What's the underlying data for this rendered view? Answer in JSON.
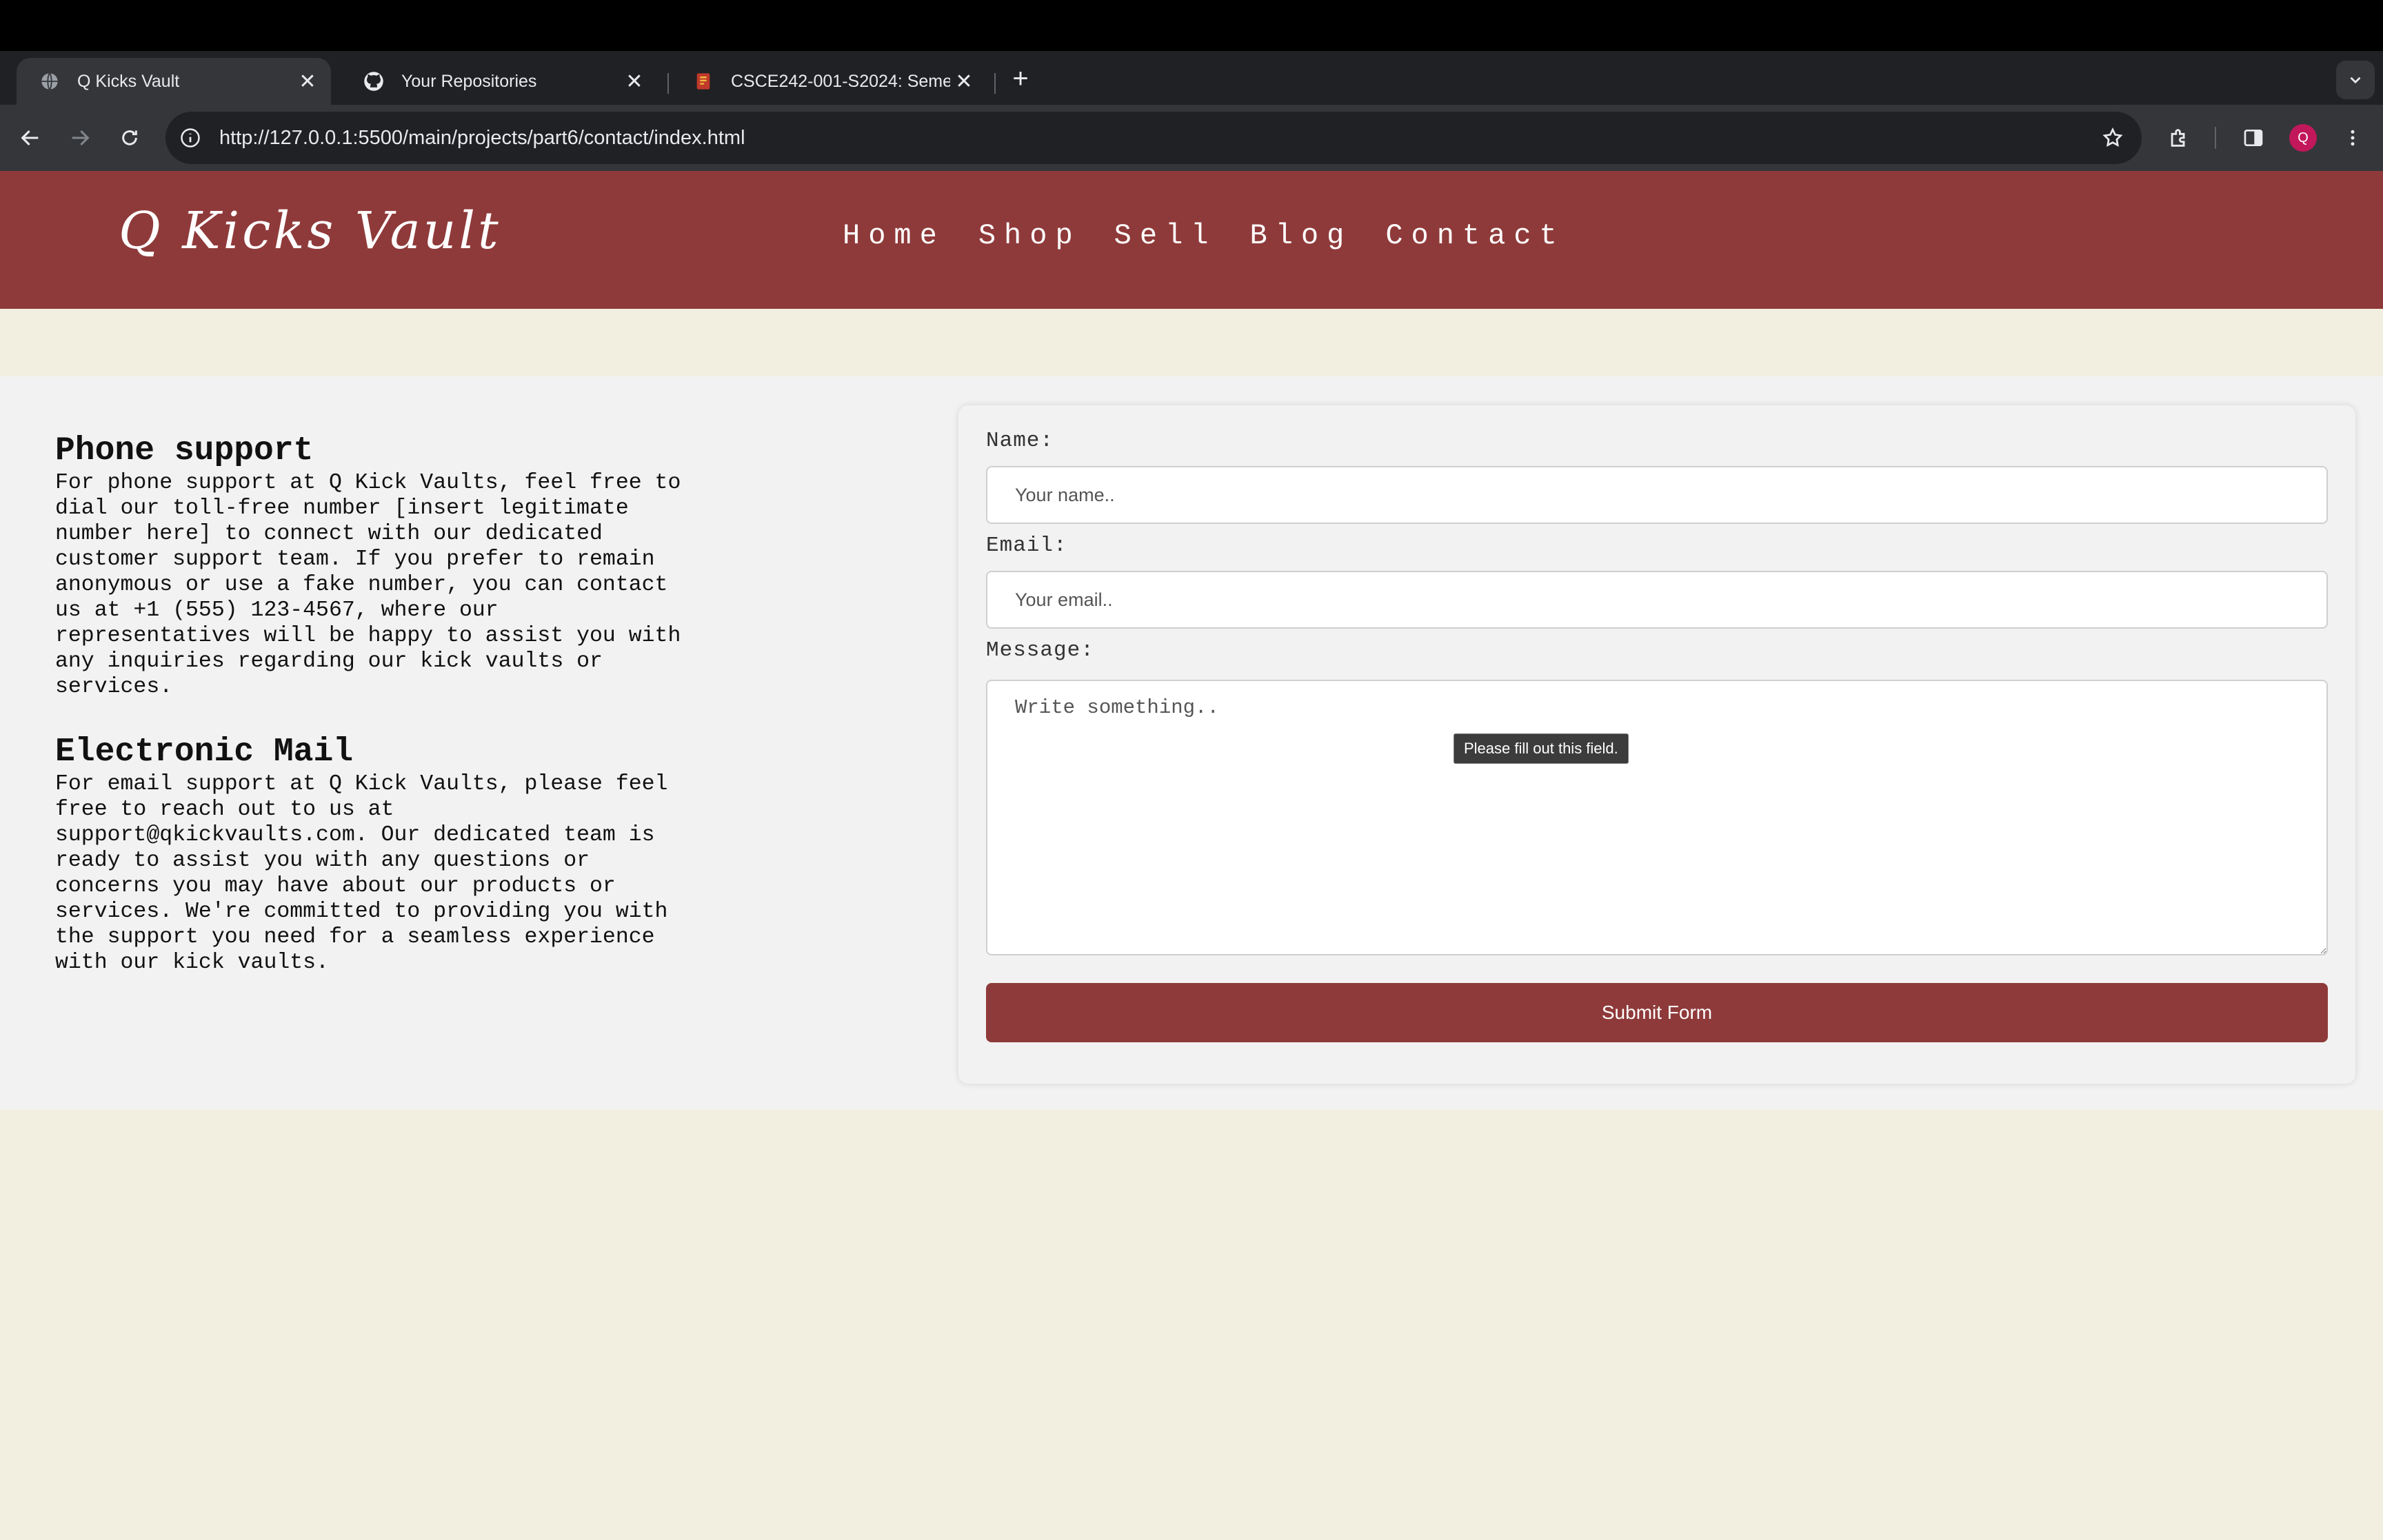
{
  "browser": {
    "tabs": [
      {
        "title": "Q Kicks Vault",
        "active": true,
        "favicon": "globe-icon"
      },
      {
        "title": "Your Repositories",
        "active": false,
        "favicon": "github-icon"
      },
      {
        "title": "CSCE242-001-S2024: Semes",
        "active": false,
        "favicon": "course-icon"
      }
    ],
    "url": "http://127.0.0.1:5500/main/projects/part6/contact/index.html",
    "profile_initial": "Q"
  },
  "site": {
    "logo": "Q Kicks Vault",
    "nav": [
      "Home",
      "Shop",
      "Sell",
      "Blog",
      "Contact"
    ],
    "colors": {
      "brand": "#8f3a3a",
      "background": "#f3efe0",
      "panel": "#f2f2f2"
    }
  },
  "info": {
    "phone_heading": "Phone support",
    "phone_text": "For phone support at Q Kick Vaults, feel free to dial our toll-free number [insert legitimate number here] to connect with our dedicated customer support team. If you prefer to remain anonymous or use a fake number, you can contact us at +1 (555) 123-4567, where our representatives will be happy to assist you with any inquiries regarding our kick vaults or services.",
    "email_heading": "Electronic Mail",
    "email_text": "For email support at Q Kick Vaults, please feel free to reach out to us at support@qkickvaults.com. Our dedicated team is ready to assist you with any questions or concerns you may have about our products or services. We're committed to providing you with the support you need for a seamless experience with our kick vaults."
  },
  "form": {
    "name_label": "Name:",
    "name_placeholder": "Your name..",
    "email_label": "Email:",
    "email_placeholder": "Your email..",
    "message_label": "Message:",
    "message_placeholder": "Write something..",
    "submit_label": "Submit Form",
    "validation_tooltip": "Please fill out this field."
  }
}
